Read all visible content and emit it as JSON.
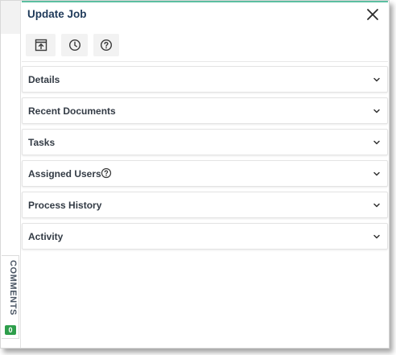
{
  "panel": {
    "title": "Update Job",
    "close_icon": "close-icon"
  },
  "toolbar": {
    "buttons": [
      {
        "icon": "open-in-window-icon"
      },
      {
        "icon": "clock-icon"
      },
      {
        "icon": "help-icon"
      }
    ]
  },
  "sections": [
    {
      "label": "Details"
    },
    {
      "label": "Recent Documents"
    },
    {
      "label": "Tasks"
    },
    {
      "label": "Assigned Users",
      "help_icon": "help-icon"
    },
    {
      "label": "Process History"
    },
    {
      "label": "Activity"
    }
  ],
  "comments": {
    "label": "COMMENTS",
    "count": "0",
    "badge_color": "#2e9e4b"
  },
  "colors": {
    "title": "#1f3a5a",
    "accent_line": "#5cbfa0",
    "section_text": "#333b45"
  }
}
